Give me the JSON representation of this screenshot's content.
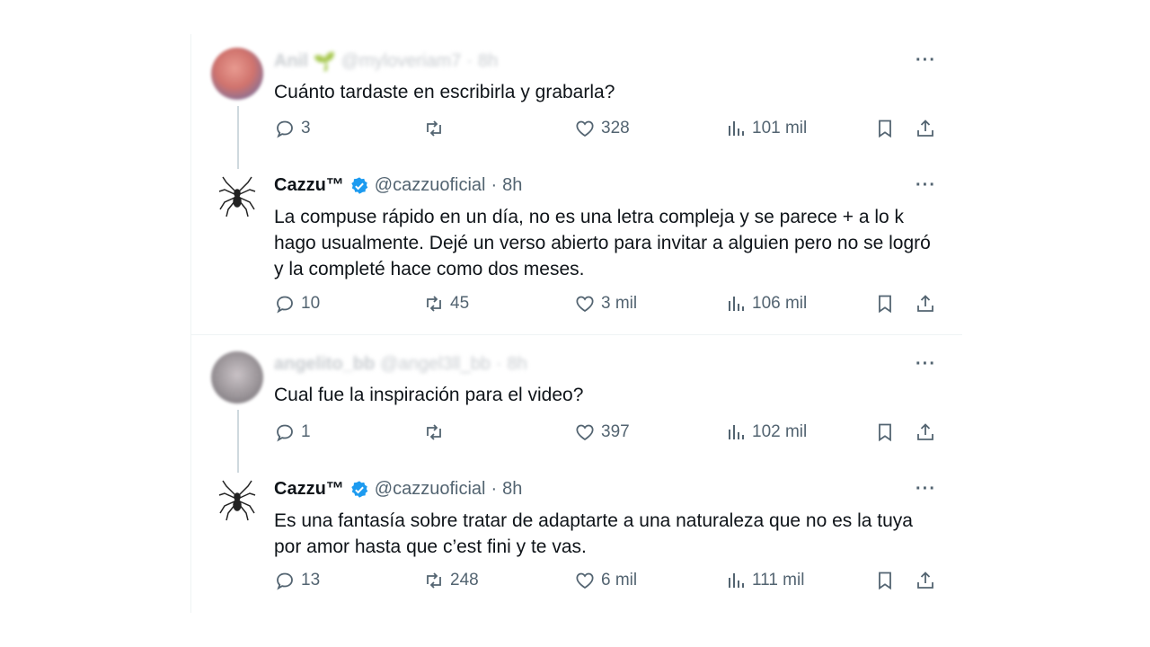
{
  "tweets": [
    {
      "name": "Anil",
      "name_extra": "🌱",
      "handle": "@myloveriam7",
      "time": "8h",
      "avatar": "blurred-red-avatar",
      "blurred": true,
      "text": "Cuánto tardaste en escribirla y grabarla?",
      "replies": "3",
      "retweets": "",
      "likes": "328",
      "views": "101 mil"
    },
    {
      "name": "Cazzu™",
      "handle": "@cazzuoficial",
      "time": "8h",
      "avatar": "spider-icon",
      "verified": true,
      "text": "La compuse rápido en un día, no es una letra compleja y se parece + a lo k hago usualmente. Dejé un verso abierto para invitar a alguien pero no se logró y la completé hace como dos meses.",
      "replies": "10",
      "retweets": "45",
      "likes": "3 mil",
      "views": "106 mil"
    },
    {
      "name": "angelito_bb",
      "handle": "@angel3ll_bb",
      "time": "8h",
      "avatar": "blurred-grey-avatar",
      "blurred": true,
      "text": "Cual fue la inspiración para el video?",
      "replies": "1",
      "retweets": "",
      "likes": "397",
      "views": "102 mil"
    },
    {
      "name": "Cazzu™",
      "handle": "@cazzuoficial",
      "time": "8h",
      "avatar": "spider-icon",
      "verified": true,
      "text": "Es una fantasía sobre tratar de adaptarte a una naturaleza que no es la tuya por amor hasta que c’est fini y te vas.",
      "replies": "13",
      "retweets": "248",
      "likes": "6 mil",
      "views": "111 mil"
    }
  ],
  "colors": {
    "accent": "#1d9bf0",
    "muted": "#536471",
    "thread_line": "#cfd9de"
  }
}
